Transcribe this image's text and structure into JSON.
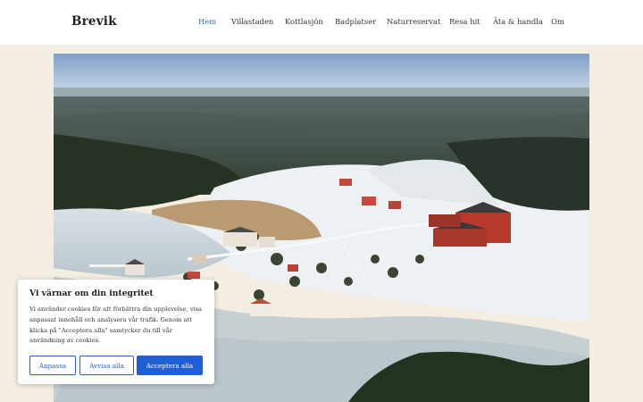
{
  "site": {
    "title": "Brevik"
  },
  "nav": {
    "items": [
      {
        "label": "Hem",
        "active": true
      },
      {
        "label": "Villastaden",
        "active": false
      },
      {
        "label": "Kottlasjön",
        "active": false
      },
      {
        "label": "Badplatser",
        "active": false
      },
      {
        "label": "Naturreservat",
        "active": false
      },
      {
        "label": "Resa hit",
        "active": false
      },
      {
        "label": "Äta & handla",
        "active": false
      },
      {
        "label": "Om",
        "active": false
      }
    ]
  },
  "cookie": {
    "title": "Vi värnar om din integritet",
    "text": "Vi använder cookies för att förbättra din upplevelse, visa anpassat innehåll och analysera vår trafik. Genom att klicka på \"Acceptera alla\" samtycker du till vår användning av cookies.",
    "customize_label": "Anpassa",
    "reject_label": "Avvisa alla",
    "accept_label": "Acceptera alla"
  },
  "colors": {
    "accent": "#1f5fd6",
    "nav_active": "#2f6db5",
    "page_bg": "#f4ede1"
  }
}
